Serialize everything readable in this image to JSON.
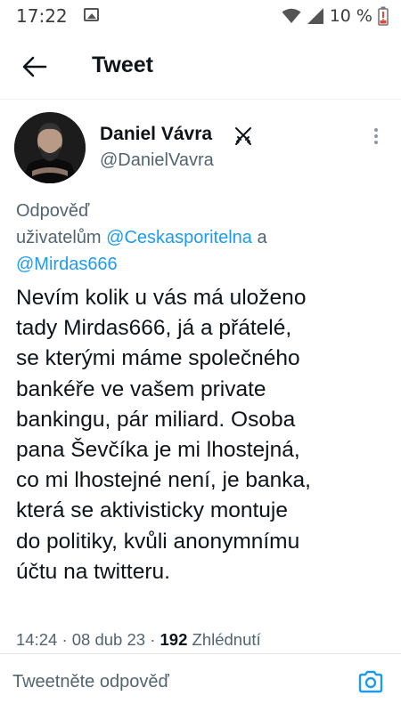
{
  "status_bar": {
    "time": "17:22",
    "battery": "10 %"
  },
  "app_bar": {
    "title": "Tweet"
  },
  "author": {
    "name": "Daniel Vávra",
    "handle": "@DanielVavra"
  },
  "reply_context": {
    "label": "Odpověď",
    "prefix": "uživatelům",
    "mention_1": "@Ceskasporitelna",
    "conjunction": "a",
    "mention_2": "@Mirdas666"
  },
  "tweet": {
    "text_lines": [
      "Nevím kolik u vás má uloženo",
      "tady Mirdas666, já a přátelé,",
      "se kterými máme společného",
      "bankéře ve vašem private",
      "bankingu, pár miliard. Osoba",
      "pana Ševčíka je mi  lhostejná,",
      "co mi lhostejné není, je banka,",
      "která se aktivisticky montuje",
      "do politiky, kvůli anonymnímu",
      "účtu na twitteru."
    ],
    "time": "14:24",
    "date": "08 dub 23",
    "separator": "·",
    "views_count": "192",
    "views_label": "Zhlédnutí"
  },
  "reply_bar": {
    "placeholder": "Tweetněte odpověď"
  },
  "colors": {
    "accent": "#1d9bf0",
    "text_primary": "#0f1419",
    "text_secondary": "#536471",
    "battery_low": "#e8443a"
  },
  "icons": {
    "back": "arrow-left-icon",
    "badge": "crossed-swords-icon",
    "more": "more-vertical-icon",
    "camera": "camera-icon",
    "status": [
      "image-icon",
      "wifi-icon",
      "signal-icon",
      "battery-icon"
    ]
  }
}
